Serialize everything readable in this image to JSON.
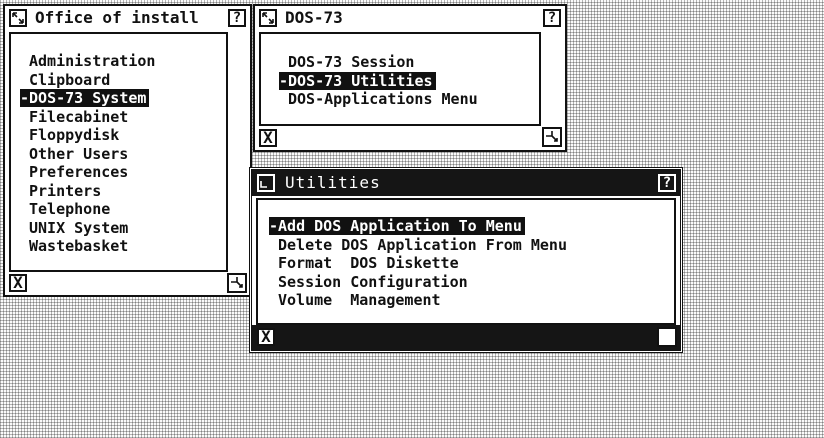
{
  "windows": {
    "office": {
      "title": "Office of install",
      "help_label": "?",
      "close_label": "X",
      "items": [
        "Administration",
        "Clipboard",
        "-DOS-73 System",
        "Filecabinet",
        "Floppydisk",
        "Other Users",
        "Preferences",
        "Printers",
        "Telephone",
        "UNIX System",
        "Wastebasket"
      ],
      "selected_index": 2
    },
    "dos73": {
      "title": "DOS-73",
      "help_label": "?",
      "close_label": "X",
      "items": [
        "DOS-73 Session",
        "-DOS-73 Utilities",
        "DOS-Applications Menu"
      ],
      "selected_index": 1
    },
    "utilities": {
      "title": "Utilities",
      "help_label": "?",
      "close_label": "X",
      "items": [
        "-Add DOS Application To Menu",
        "Delete DOS Application From Menu",
        "Format  DOS Diskette",
        "Session Configuration",
        "Volume  Management"
      ],
      "selected_index": 0
    }
  }
}
